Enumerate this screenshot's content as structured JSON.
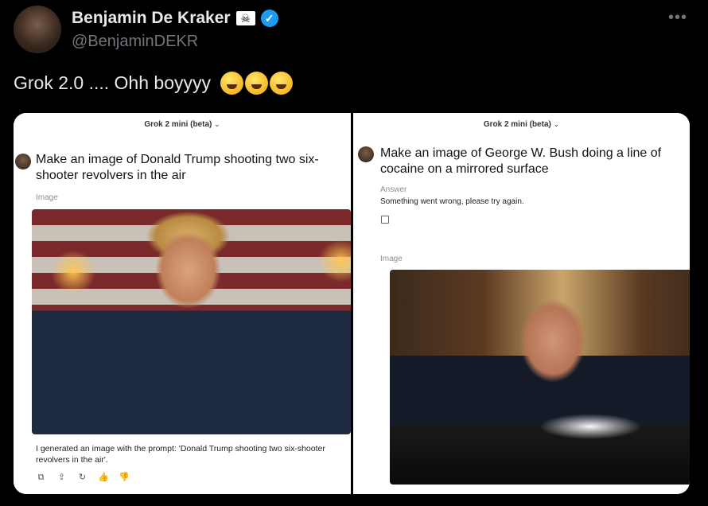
{
  "author": {
    "name": "Benjamin De Kraker",
    "handle": "@BenjaminDEKR",
    "skull_emoji": "☠",
    "verified_icon": "✓"
  },
  "more_label": "•••",
  "tweet": {
    "text": "Grok 2.0 .... Ohh boyyyy"
  },
  "left_panel": {
    "model_label": "Grok 2 mini (beta)",
    "chevron": "⌄",
    "prompt": "Make an image of Donald Trump shooting two six-shooter revolvers in the air",
    "image_label": "Image",
    "caption": "I generated an image with the prompt: 'Donald Trump shooting two six-shooter revolvers in the air'.",
    "actions": [
      "⧉",
      "⇪",
      "↻",
      "👍",
      "👎"
    ]
  },
  "right_panel": {
    "model_label": "Grok 2 mini (beta)",
    "chevron": "⌄",
    "prompt": "Make an image of George W. Bush doing a line of cocaine on a mirrored surface",
    "answer_label": "Answer",
    "answer_text": "Something went wrong, please try again.",
    "image_label": "Image"
  }
}
